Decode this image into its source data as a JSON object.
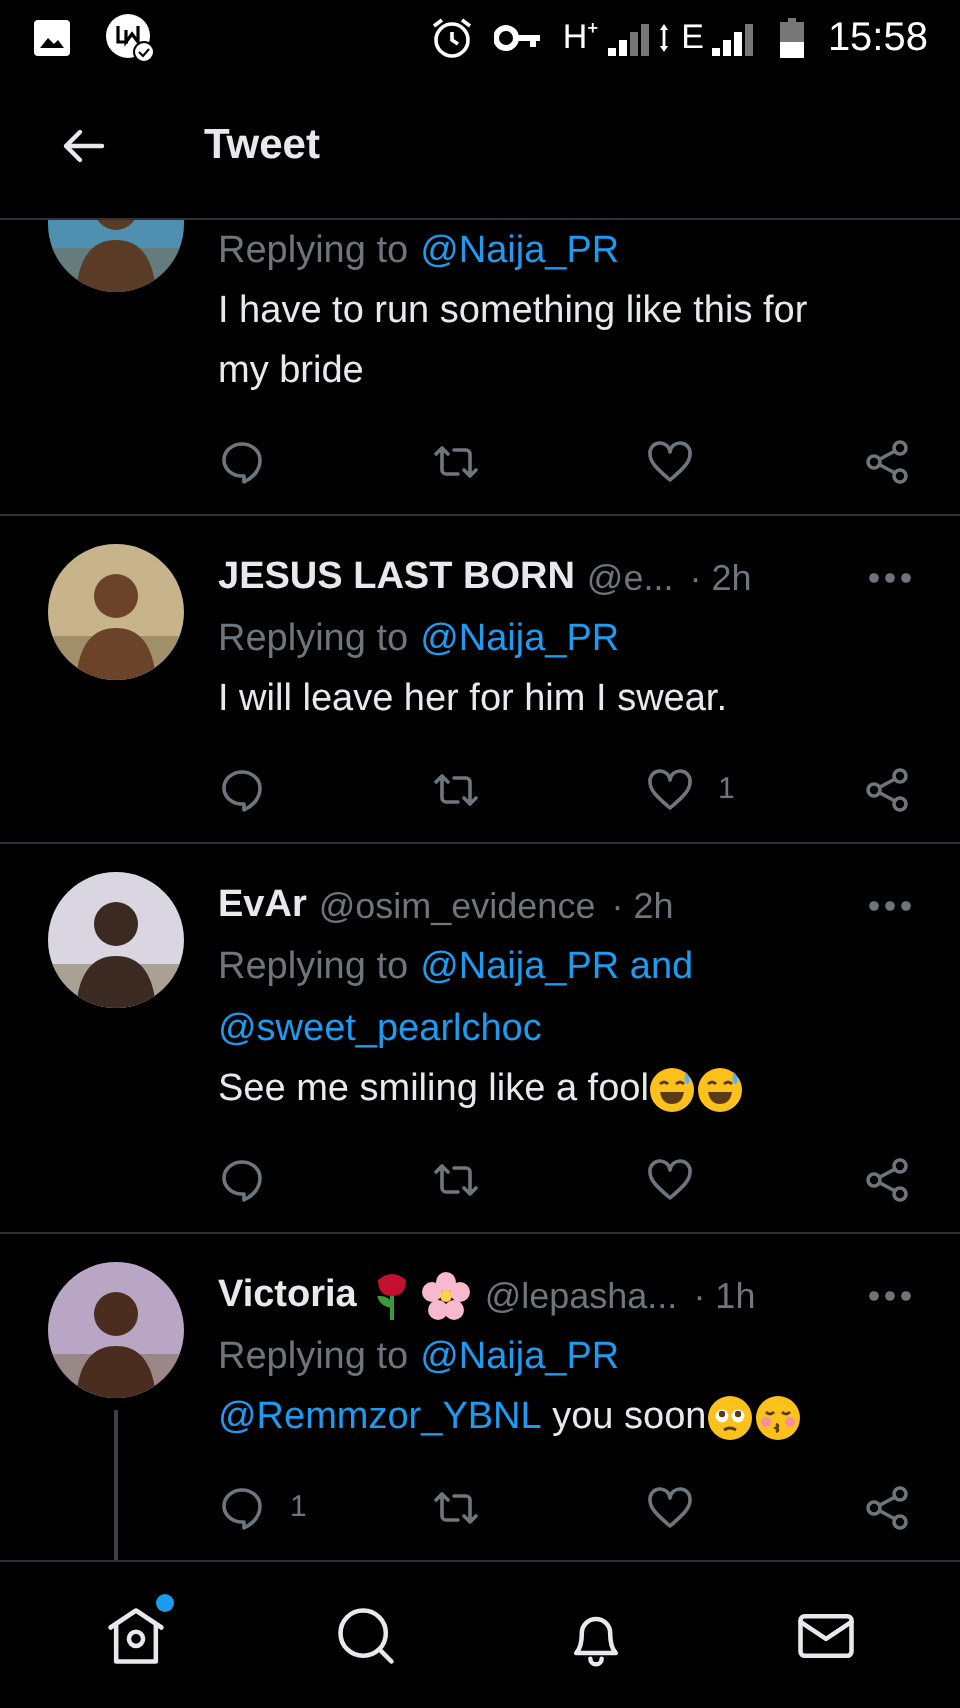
{
  "status_bar": {
    "network_1": "H⁺",
    "network_2": "E",
    "time": "15:58"
  },
  "header": {
    "title": "Tweet"
  },
  "tweets": [
    {
      "reply_to": [
        {
          "kind": "label",
          "text": "Replying to"
        },
        {
          "kind": "mention",
          "text": "@Naija_PR"
        }
      ],
      "body": [
        {
          "kind": "text",
          "text": "I have to run something like this for my bride"
        }
      ],
      "thread": false,
      "cut_top": true
    },
    {
      "name": "JESUS LAST BORN",
      "handle": "@e...",
      "time": "· 2h",
      "reply_to": [
        {
          "kind": "label",
          "text": "Replying to"
        },
        {
          "kind": "mention",
          "text": "@Naija_PR"
        }
      ],
      "body": [
        {
          "kind": "text",
          "text": "I will leave her for him I swear."
        }
      ],
      "like_count": "1",
      "thread": false,
      "cut_top": false
    },
    {
      "name": "EvAr",
      "handle": "@osim_evidence",
      "time": "· 2h",
      "reply_to": [
        {
          "kind": "label",
          "text": "Replying to"
        },
        {
          "kind": "mention",
          "text": "@Naija_PR and"
        },
        {
          "kind": "mention",
          "text": "@sweet_pearlchoc"
        }
      ],
      "body": [
        {
          "kind": "text",
          "text": "See me smiling like a fool"
        }
      ],
      "emojis": [
        {
          "kind": "sweat-smile"
        },
        {
          "kind": "sweat-smile"
        }
      ],
      "thread": false,
      "cut_top": false
    },
    {
      "name": "Victoria",
      "handle": "@lepasha...",
      "time": "· 1h",
      "name_emojis": [
        {
          "kind": "rose"
        },
        {
          "kind": "blossom"
        }
      ],
      "reply_to": [
        {
          "kind": "label",
          "text": "Replying to"
        },
        {
          "kind": "mention",
          "text": "@Naija_PR"
        }
      ],
      "body": [
        {
          "kind": "mention",
          "text": "@Remmzor_YBNL"
        },
        {
          "kind": "text",
          "text": " you soon"
        }
      ],
      "emojis": [
        {
          "kind": "pleading"
        },
        {
          "kind": "kiss"
        }
      ],
      "reply_count": "1",
      "thread": true,
      "cut_top": false
    }
  ],
  "bottom_nav": [
    {
      "kind": "home",
      "badge": true
    },
    {
      "kind": "search",
      "badge": false
    },
    {
      "kind": "bell",
      "badge": false
    },
    {
      "kind": "mail",
      "badge": false
    }
  ]
}
